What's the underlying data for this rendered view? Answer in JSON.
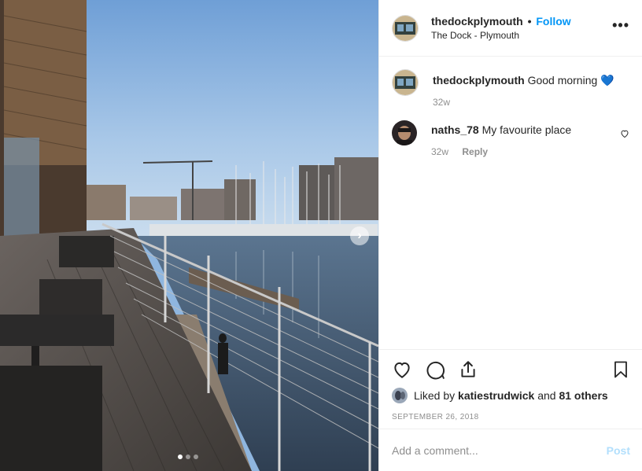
{
  "post": {
    "username": "thedockplymouth",
    "separator": "•",
    "follow_label": "Follow",
    "location": "The Dock - Plymouth",
    "more_icon": "more-options-icon"
  },
  "carousel": {
    "next_icon": "chevron-right-icon",
    "page_count": 3,
    "active_index": 0
  },
  "comments": [
    {
      "username": "thedockplymouth",
      "text": "Good morning 💙",
      "age": "32w",
      "reply_label": ""
    },
    {
      "username": "naths_78",
      "text": "My favourite place",
      "age": "32w",
      "reply_label": "Reply"
    }
  ],
  "actions": {
    "like_icon": "heart-icon",
    "comment_icon": "comment-icon",
    "share_icon": "share-icon",
    "save_icon": "bookmark-icon"
  },
  "likes": {
    "prefix": "Liked by",
    "first_user": "katiestrudwick",
    "connector": "and",
    "others": "81 others"
  },
  "date": "SEPTEMBER 26, 2018",
  "add_comment": {
    "placeholder": "Add a comment...",
    "post_label": "Post"
  },
  "colors": {
    "accent": "#0095f6",
    "post_disabled": "#b2dffc",
    "muted": "#8e8e8e"
  }
}
